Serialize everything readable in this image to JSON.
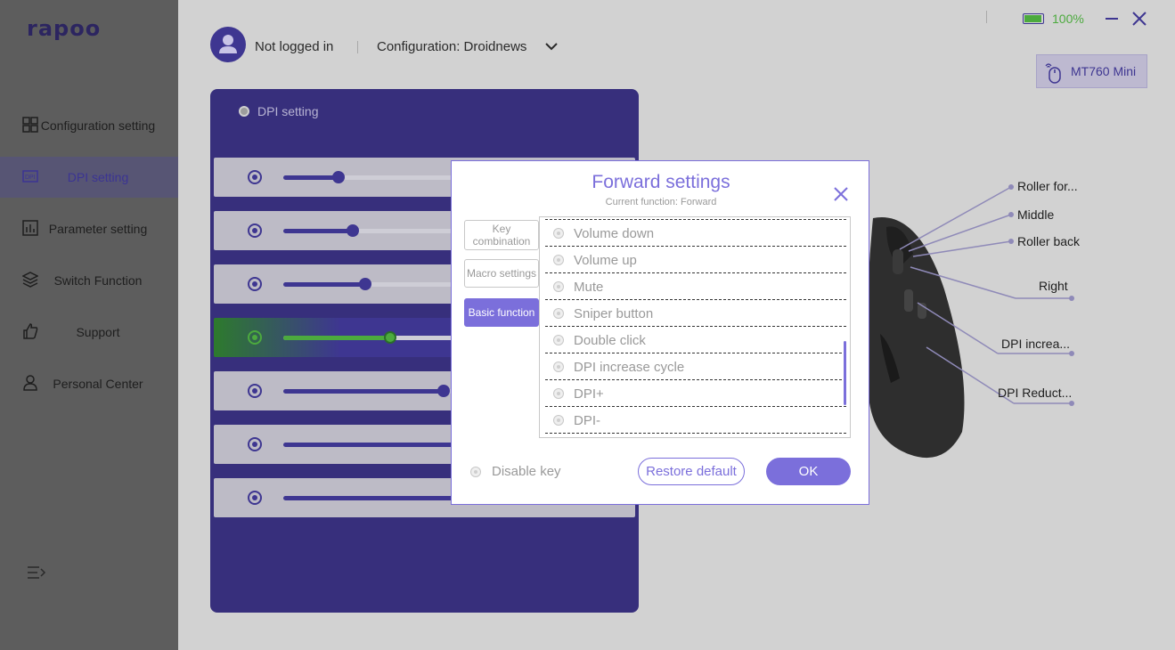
{
  "app": {
    "logo_text": "rapoo"
  },
  "sidebar": {
    "items": [
      {
        "label": "Configuration setting",
        "icon": "grid-icon"
      },
      {
        "label": "DPI setting",
        "icon": "dpi-icon"
      },
      {
        "label": "Parameter setting",
        "icon": "bar-chart-icon"
      },
      {
        "label": "Switch Function",
        "icon": "layers-icon"
      },
      {
        "label": "Support",
        "icon": "thumbs-up-icon"
      },
      {
        "label": "Personal Center",
        "icon": "person-icon"
      }
    ],
    "active_index": 1
  },
  "header": {
    "user_label": "Not logged in",
    "config_label": "Configuration: Droidnews",
    "battery_pct": "100%",
    "device_name": "MT760 Mini"
  },
  "dpi_panel": {
    "title": "DPI setting",
    "rows": [
      {
        "fill_fraction": 0.31,
        "active": false
      },
      {
        "fill_fraction": 0.39,
        "active": false
      },
      {
        "fill_fraction": 0.46,
        "active": false
      },
      {
        "fill_fraction": 0.6,
        "active": true
      },
      {
        "fill_fraction": 0.9,
        "active": false
      },
      {
        "fill_fraction": 1.0,
        "active": false
      },
      {
        "fill_fraction": 1.0,
        "active": false
      }
    ]
  },
  "mouse_callouts": {
    "roller_forward": "Roller for...",
    "middle": "Middle",
    "roller_back": "Roller back",
    "right": "Right",
    "dpi_increase": "DPI increa...",
    "dpi_reduction": "DPI Reduct..."
  },
  "modal": {
    "title": "Forward settings",
    "subtitle": "Current function: Forward",
    "tabs": [
      {
        "label": "Key combination",
        "active": false
      },
      {
        "label": "Macro settings",
        "active": false
      },
      {
        "label": "Basic function",
        "active": true
      }
    ],
    "list_items": [
      "Volume down",
      "Volume up",
      "Mute",
      "Sniper button",
      "Double click",
      "DPI increase cycle",
      "DPI+",
      "DPI-"
    ],
    "disable_key_label": "Disable key",
    "restore_label": "Restore default",
    "ok_label": "OK"
  },
  "colors": {
    "accent": "#7b6fdb",
    "battery_green": "#4caa3e"
  }
}
